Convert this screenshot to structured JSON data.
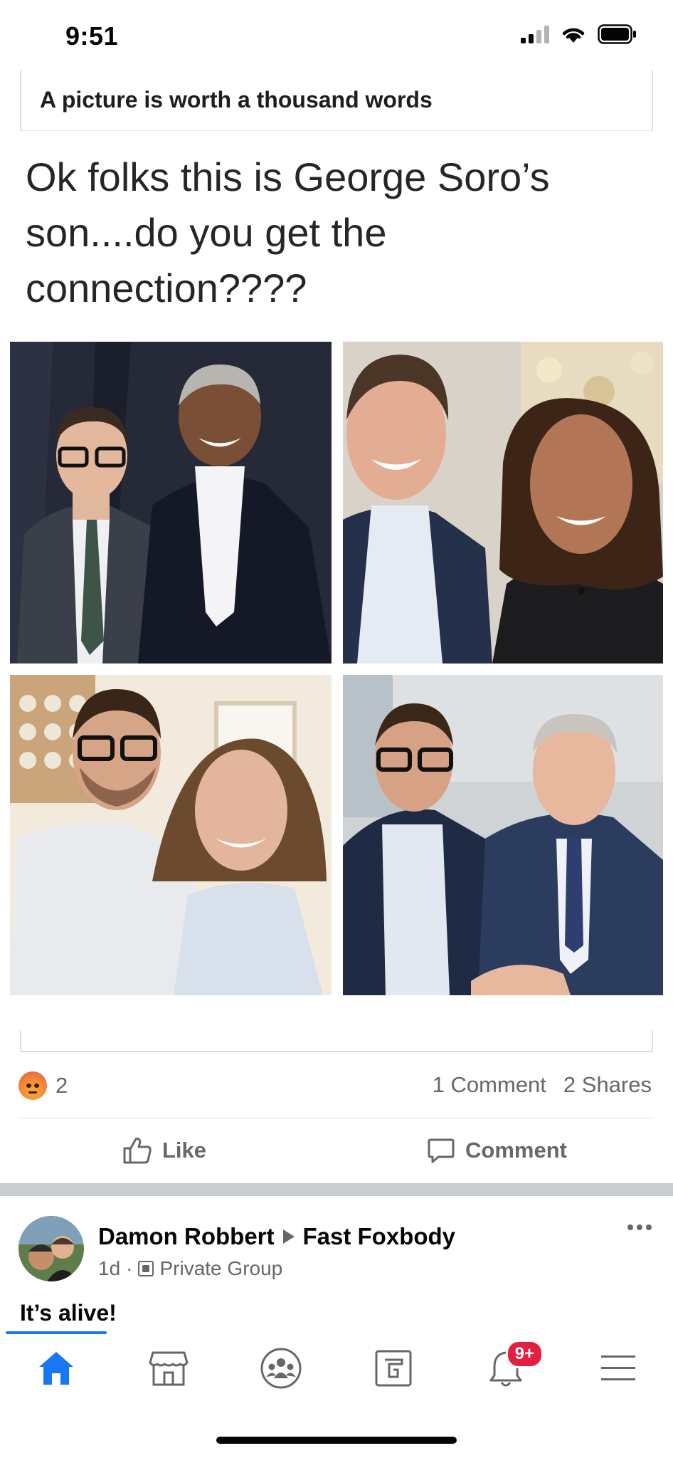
{
  "status_bar": {
    "time": "9:51",
    "icons": [
      "signal-icon",
      "wifi-icon",
      "battery-icon"
    ]
  },
  "shared_card": {
    "title": "A picture is worth a thousand words"
  },
  "post": {
    "text": "Ok folks this is George Soro’s son....do you get the connection????",
    "reaction_count": "2",
    "comments": "1 Comment",
    "shares": "2 Shares",
    "like_label": "Like",
    "comment_label": "Comment"
  },
  "next_post": {
    "author": "Damon Robbert",
    "group": "Fast Foxbody",
    "time": "1d",
    "separator": "·",
    "privacy": "Private Group",
    "text": "It’s alive!"
  },
  "nav": {
    "items": [
      "home-icon",
      "marketplace-icon",
      "groups-icon",
      "gaming-icon",
      "notifications-icon",
      "menu-icon"
    ],
    "notification_badge": "9+",
    "active_color": "#1877f2"
  }
}
